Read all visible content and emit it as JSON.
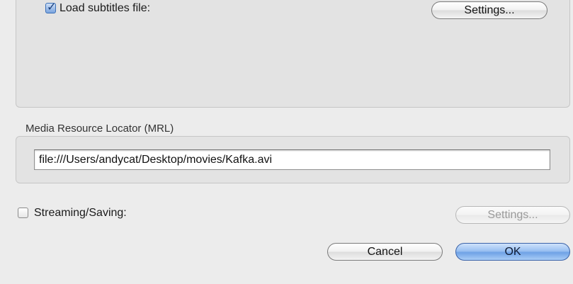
{
  "subtitles": {
    "checkbox_checked": true,
    "checkbox_mark": "✓",
    "label": "Load subtitles file:",
    "settings_button": "Settings..."
  },
  "mrl": {
    "section_title": "Media Resource Locator (MRL)",
    "value": "file:///Users/andycat/Desktop/movies/Kafka.avi"
  },
  "streaming": {
    "checkbox_checked": false,
    "label": "Streaming/Saving:",
    "settings_button": "Settings..."
  },
  "actions": {
    "cancel_label": "Cancel",
    "ok_label": "OK"
  },
  "colors": {
    "default_button": "#7aa9ea",
    "checkbox_checked": "#3b6fb6",
    "background": "#ececec"
  }
}
